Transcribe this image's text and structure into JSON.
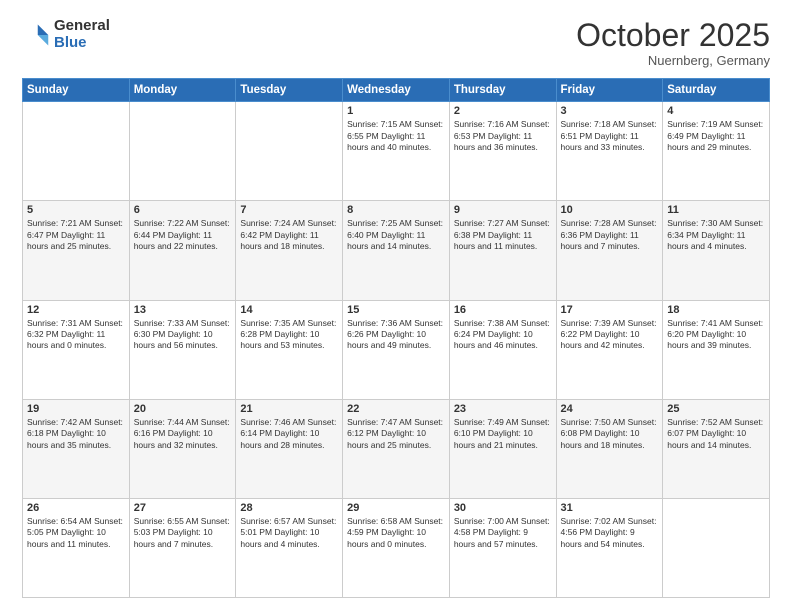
{
  "logo": {
    "general": "General",
    "blue": "Blue"
  },
  "title": "October 2025",
  "location": "Nuernberg, Germany",
  "days_of_week": [
    "Sunday",
    "Monday",
    "Tuesday",
    "Wednesday",
    "Thursday",
    "Friday",
    "Saturday"
  ],
  "weeks": [
    [
      {
        "day": "",
        "info": ""
      },
      {
        "day": "",
        "info": ""
      },
      {
        "day": "",
        "info": ""
      },
      {
        "day": "1",
        "info": "Sunrise: 7:15 AM\nSunset: 6:55 PM\nDaylight: 11 hours\nand 40 minutes."
      },
      {
        "day": "2",
        "info": "Sunrise: 7:16 AM\nSunset: 6:53 PM\nDaylight: 11 hours\nand 36 minutes."
      },
      {
        "day": "3",
        "info": "Sunrise: 7:18 AM\nSunset: 6:51 PM\nDaylight: 11 hours\nand 33 minutes."
      },
      {
        "day": "4",
        "info": "Sunrise: 7:19 AM\nSunset: 6:49 PM\nDaylight: 11 hours\nand 29 minutes."
      }
    ],
    [
      {
        "day": "5",
        "info": "Sunrise: 7:21 AM\nSunset: 6:47 PM\nDaylight: 11 hours\nand 25 minutes."
      },
      {
        "day": "6",
        "info": "Sunrise: 7:22 AM\nSunset: 6:44 PM\nDaylight: 11 hours\nand 22 minutes."
      },
      {
        "day": "7",
        "info": "Sunrise: 7:24 AM\nSunset: 6:42 PM\nDaylight: 11 hours\nand 18 minutes."
      },
      {
        "day": "8",
        "info": "Sunrise: 7:25 AM\nSunset: 6:40 PM\nDaylight: 11 hours\nand 14 minutes."
      },
      {
        "day": "9",
        "info": "Sunrise: 7:27 AM\nSunset: 6:38 PM\nDaylight: 11 hours\nand 11 minutes."
      },
      {
        "day": "10",
        "info": "Sunrise: 7:28 AM\nSunset: 6:36 PM\nDaylight: 11 hours\nand 7 minutes."
      },
      {
        "day": "11",
        "info": "Sunrise: 7:30 AM\nSunset: 6:34 PM\nDaylight: 11 hours\nand 4 minutes."
      }
    ],
    [
      {
        "day": "12",
        "info": "Sunrise: 7:31 AM\nSunset: 6:32 PM\nDaylight: 11 hours\nand 0 minutes."
      },
      {
        "day": "13",
        "info": "Sunrise: 7:33 AM\nSunset: 6:30 PM\nDaylight: 10 hours\nand 56 minutes."
      },
      {
        "day": "14",
        "info": "Sunrise: 7:35 AM\nSunset: 6:28 PM\nDaylight: 10 hours\nand 53 minutes."
      },
      {
        "day": "15",
        "info": "Sunrise: 7:36 AM\nSunset: 6:26 PM\nDaylight: 10 hours\nand 49 minutes."
      },
      {
        "day": "16",
        "info": "Sunrise: 7:38 AM\nSunset: 6:24 PM\nDaylight: 10 hours\nand 46 minutes."
      },
      {
        "day": "17",
        "info": "Sunrise: 7:39 AM\nSunset: 6:22 PM\nDaylight: 10 hours\nand 42 minutes."
      },
      {
        "day": "18",
        "info": "Sunrise: 7:41 AM\nSunset: 6:20 PM\nDaylight: 10 hours\nand 39 minutes."
      }
    ],
    [
      {
        "day": "19",
        "info": "Sunrise: 7:42 AM\nSunset: 6:18 PM\nDaylight: 10 hours\nand 35 minutes."
      },
      {
        "day": "20",
        "info": "Sunrise: 7:44 AM\nSunset: 6:16 PM\nDaylight: 10 hours\nand 32 minutes."
      },
      {
        "day": "21",
        "info": "Sunrise: 7:46 AM\nSunset: 6:14 PM\nDaylight: 10 hours\nand 28 minutes."
      },
      {
        "day": "22",
        "info": "Sunrise: 7:47 AM\nSunset: 6:12 PM\nDaylight: 10 hours\nand 25 minutes."
      },
      {
        "day": "23",
        "info": "Sunrise: 7:49 AM\nSunset: 6:10 PM\nDaylight: 10 hours\nand 21 minutes."
      },
      {
        "day": "24",
        "info": "Sunrise: 7:50 AM\nSunset: 6:08 PM\nDaylight: 10 hours\nand 18 minutes."
      },
      {
        "day": "25",
        "info": "Sunrise: 7:52 AM\nSunset: 6:07 PM\nDaylight: 10 hours\nand 14 minutes."
      }
    ],
    [
      {
        "day": "26",
        "info": "Sunrise: 6:54 AM\nSunset: 5:05 PM\nDaylight: 10 hours\nand 11 minutes."
      },
      {
        "day": "27",
        "info": "Sunrise: 6:55 AM\nSunset: 5:03 PM\nDaylight: 10 hours\nand 7 minutes."
      },
      {
        "day": "28",
        "info": "Sunrise: 6:57 AM\nSunset: 5:01 PM\nDaylight: 10 hours\nand 4 minutes."
      },
      {
        "day": "29",
        "info": "Sunrise: 6:58 AM\nSunset: 4:59 PM\nDaylight: 10 hours\nand 0 minutes."
      },
      {
        "day": "30",
        "info": "Sunrise: 7:00 AM\nSunset: 4:58 PM\nDaylight: 9 hours\nand 57 minutes."
      },
      {
        "day": "31",
        "info": "Sunrise: 7:02 AM\nSunset: 4:56 PM\nDaylight: 9 hours\nand 54 minutes."
      },
      {
        "day": "",
        "info": ""
      }
    ]
  ]
}
